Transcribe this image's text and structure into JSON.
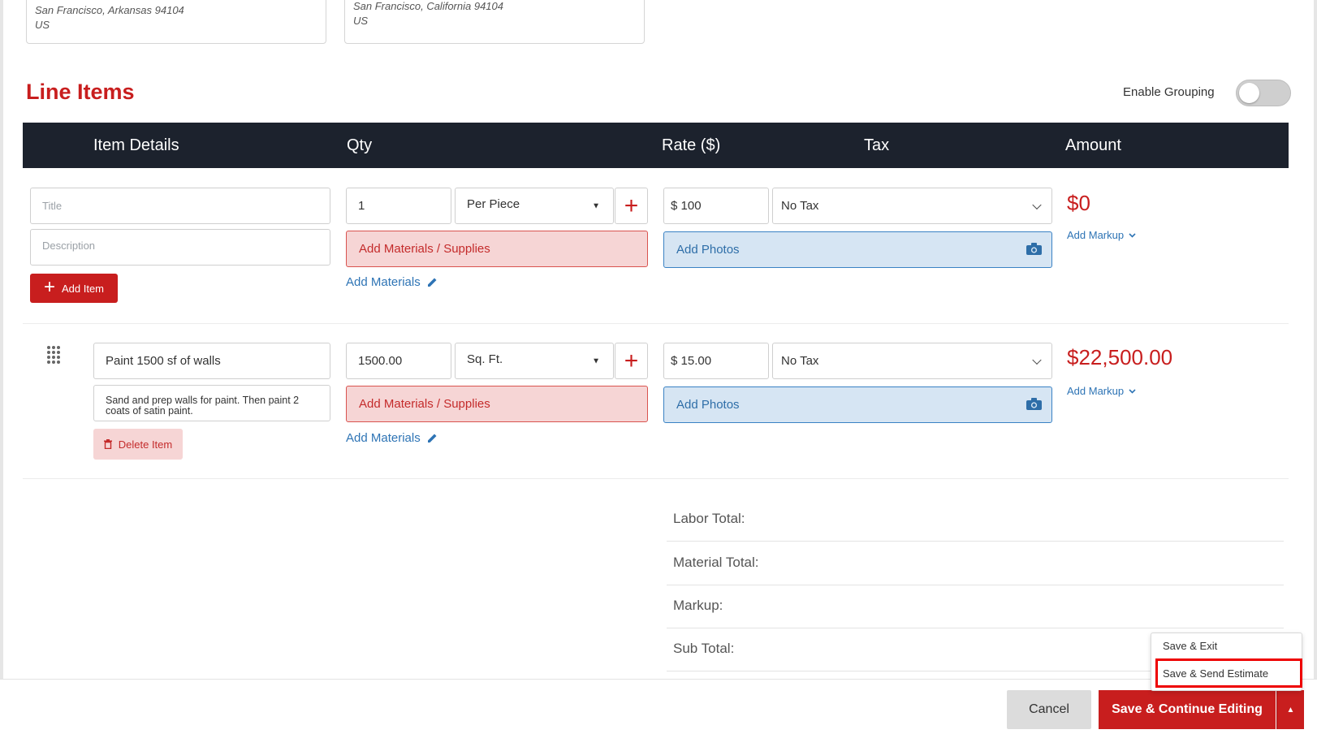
{
  "addresses": [
    {
      "line1": "San Francisco, Arkansas 94104",
      "line2": "US"
    },
    {
      "line1": "San Francisco, California 94104",
      "line2": "US"
    }
  ],
  "section_title": "Line Items",
  "grouping": {
    "label": "Enable Grouping",
    "enabled": false
  },
  "table": {
    "headers": [
      "Item Details",
      "Qty",
      "Rate ($)",
      "Tax",
      "Amount"
    ]
  },
  "new_item": {
    "title_placeholder": "Title",
    "description_placeholder": "Description",
    "add_item_label": "Add Item",
    "qty": "1",
    "unit": "Per Piece",
    "rate": "$ 100",
    "tax": "No Tax",
    "materials_label": "Add Materials / Supplies",
    "add_materials_link": "Add Materials",
    "photos_label": "Add Photos",
    "amount": "$0",
    "add_markup": "Add Markup"
  },
  "line_item": {
    "title": "Paint 1500 sf of walls",
    "description": "Sand and prep walls for paint.  Then paint 2 coats of satin paint.",
    "delete_label": "Delete Item",
    "qty": "1500.00",
    "unit": "Sq. Ft.",
    "rate": "$ 15.00",
    "tax": "No Tax",
    "materials_label": "Add Materials / Supplies",
    "add_materials_link": "Add Materials",
    "photos_label": "Add Photos",
    "amount": "$22,500.00",
    "add_markup": "Add Markup"
  },
  "totals": [
    "Labor Total:",
    "Material Total:",
    "Markup:",
    "Sub Total:"
  ],
  "footer": {
    "cancel": "Cancel",
    "save_continue": "Save & Continue Editing",
    "menu": [
      "Save & Exit",
      "Save & Send Estimate"
    ]
  },
  "colors": {
    "accent_red": "#c81e1e",
    "header_dark": "#1c222d",
    "link_blue": "#2e74b5"
  }
}
